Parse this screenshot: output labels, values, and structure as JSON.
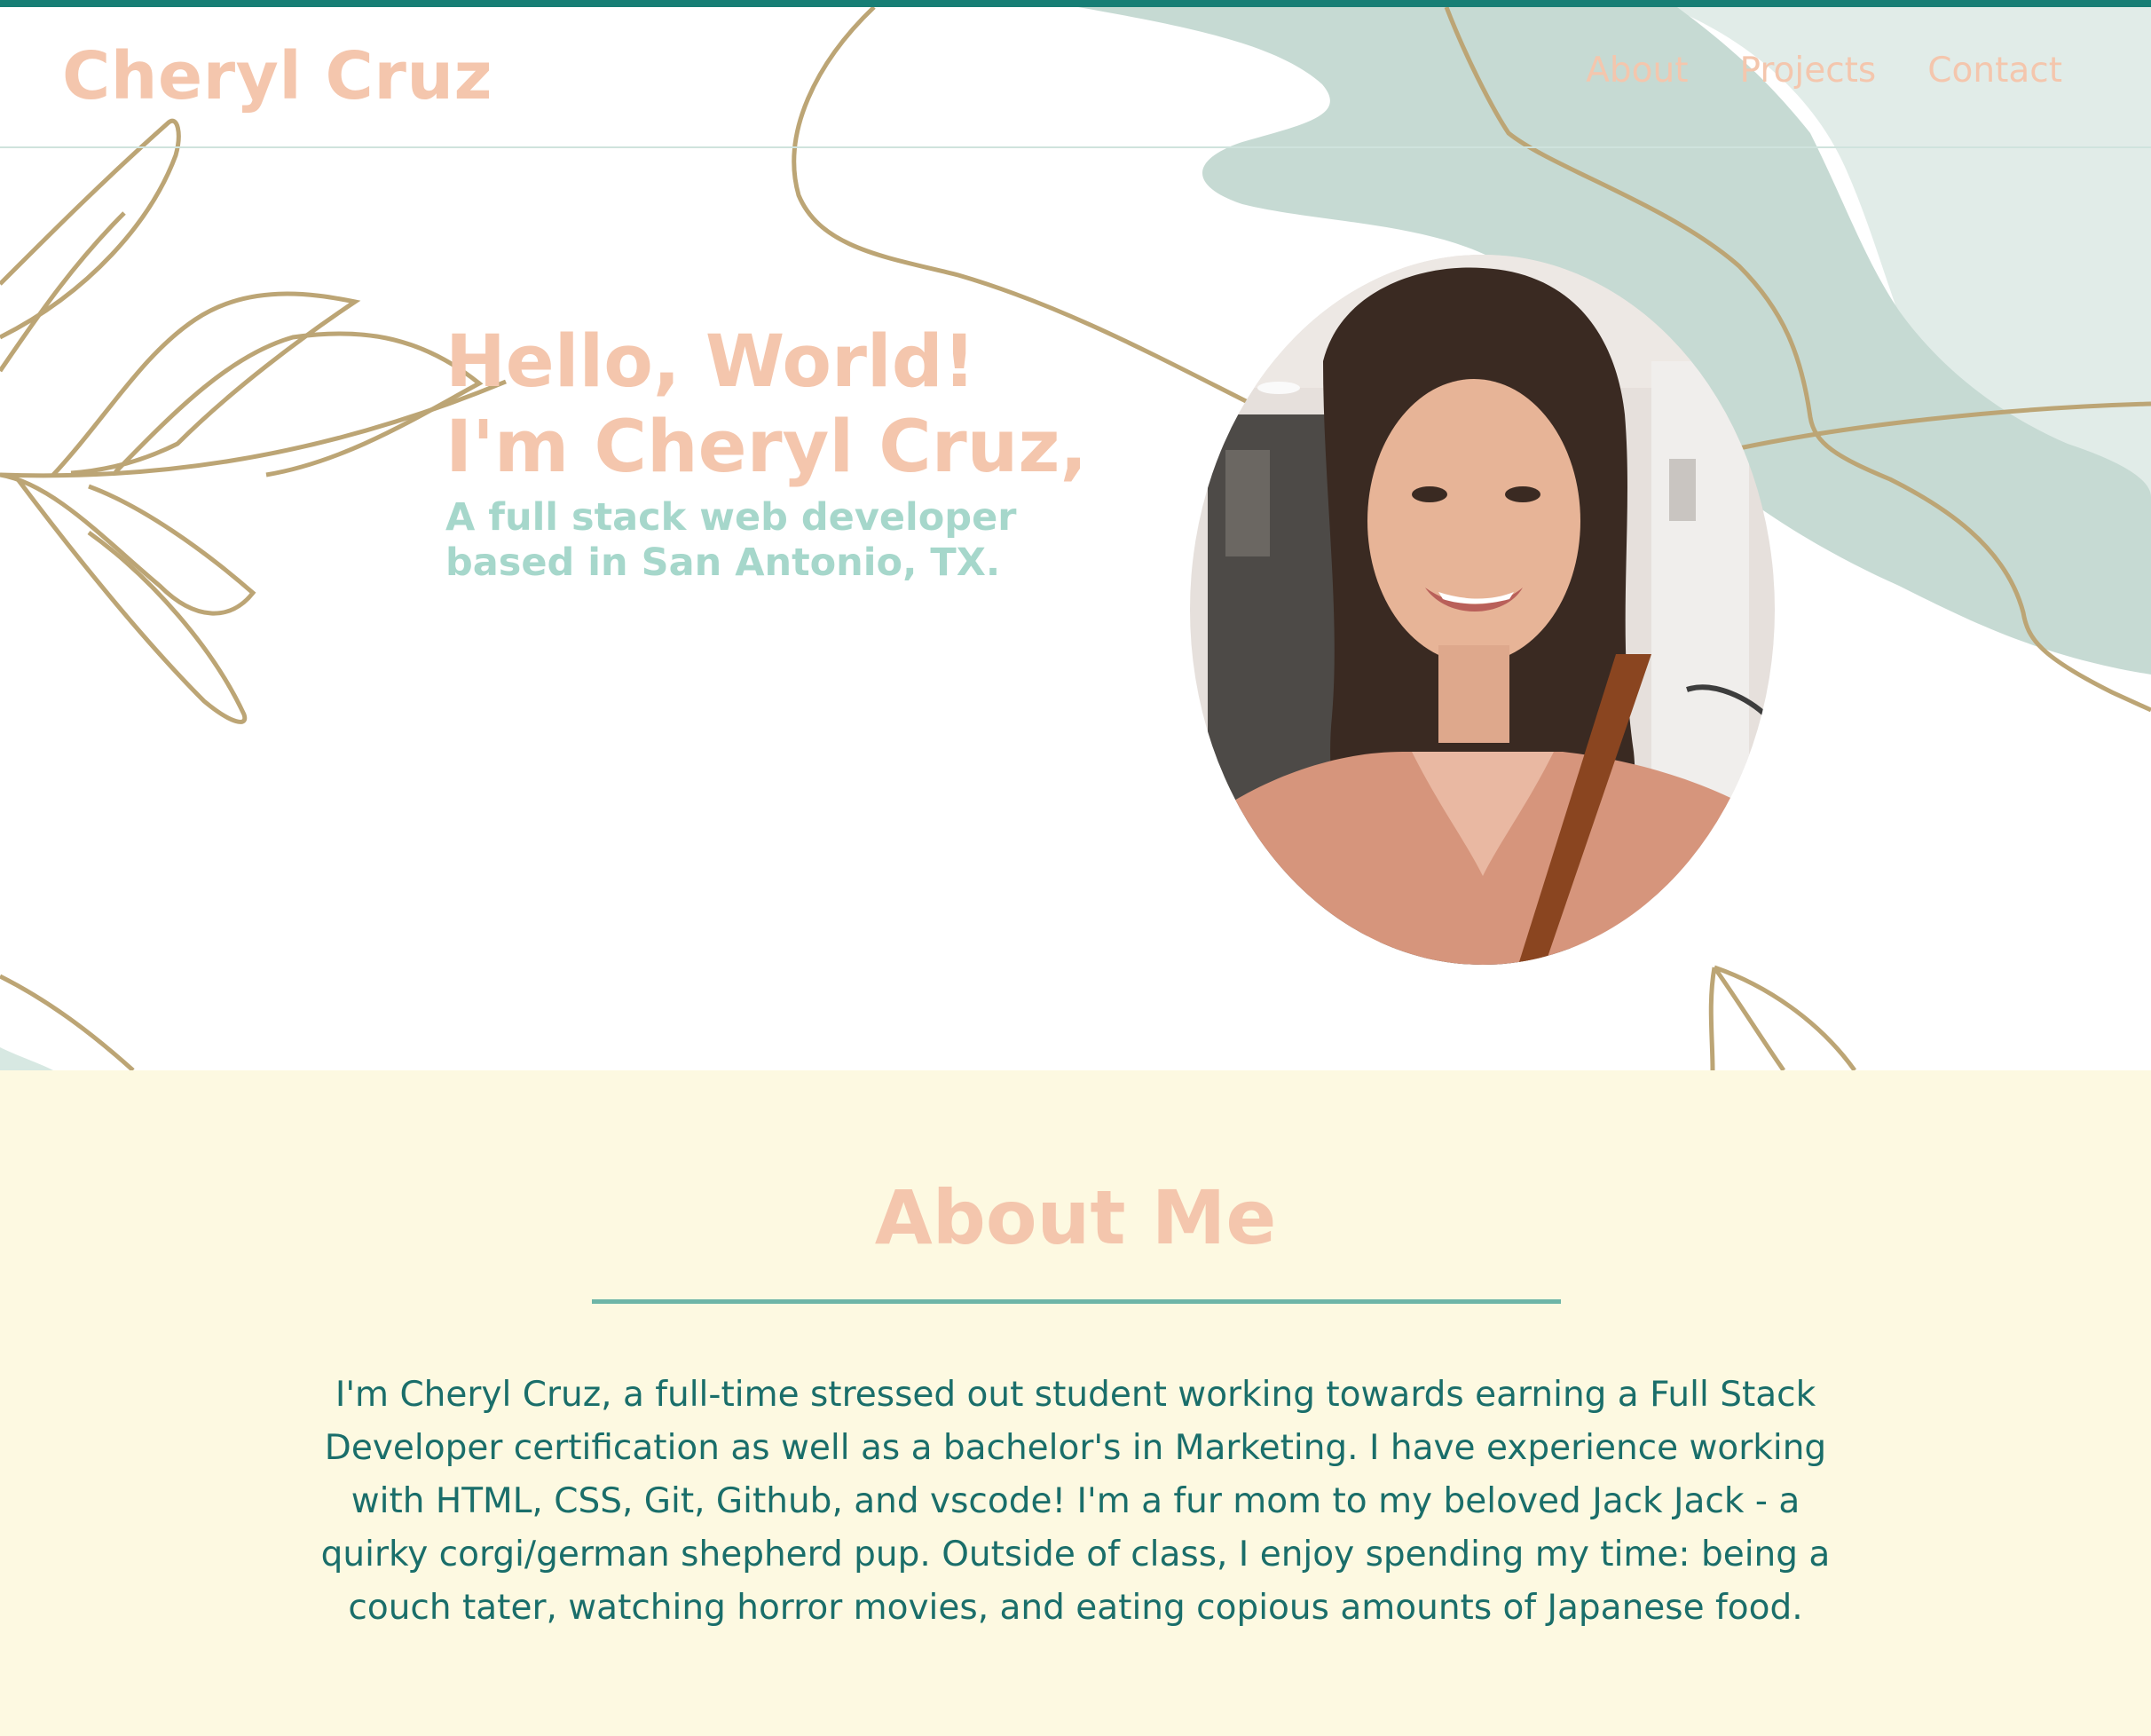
{
  "header": {
    "brand": "Cheryl Cruz",
    "nav": [
      {
        "label": "About"
      },
      {
        "label": "Projects"
      },
      {
        "label": "Contact"
      }
    ]
  },
  "hero": {
    "greeting": "Hello, World!",
    "intro": "I'm Cheryl Cruz,",
    "subtitle": "A full stack web developer based in San Antonio, TX."
  },
  "about": {
    "heading": "About Me",
    "bio": "I'm Cheryl Cruz, a full-time stressed out student working towards earning a Full Stack Developer certification as well as a bachelor's in Marketing. I have experience working with HTML, CSS, Git, Github, and vscode! I'm a fur mom to my beloved Jack Jack - a quirky corgi/german shepherd pup. Outside of class, I enjoy spending my time: being a couch tater, watching horror movies, and eating copious amounts of Japanese food."
  },
  "colors": {
    "accent_teal": "#177e75",
    "peach": "#f4c6ad",
    "mint": "#a6d7cb",
    "sage": "#c6dad3",
    "gold_line": "#bca575",
    "cream": "#fdf9e1",
    "body_text": "#1a6e6a"
  }
}
